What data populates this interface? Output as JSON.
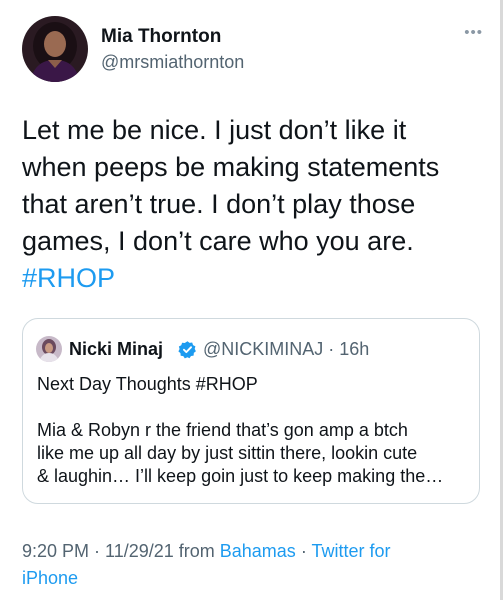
{
  "author": {
    "name": "Mia Thornton",
    "handle": "@mrsmiathornton"
  },
  "menu_icon": "more-horizontal-icon",
  "tweet_lines": [
    "Let me be nice.  I just don’t like it",
    "when peeps be making statements",
    "that aren’t true.  I don’t play those",
    "games, I don’t care who you are."
  ],
  "hashtag": "#RHOP",
  "quoted": {
    "name": "Nicki Minaj",
    "handle_time": "@NICKIMINAJ · 16h",
    "verified_icon": "verified-badge-icon",
    "line1": "Next Day Thoughts #RHOP",
    "lines": [
      "Mia & Robyn r the friend that’s gon amp a btch",
      "like me up all day by just sittin there, lookin cute",
      "& laughin… I’ll keep goin just to keep making the…"
    ]
  },
  "meta": {
    "timestamp": "9:20 PM · 11/29/21 from ",
    "location": "Bahamas",
    "separator": " · ",
    "source_part1": "Twitter for",
    "source_part2": "iPhone"
  },
  "colors": {
    "link": "#1d9bf0",
    "secondary_text": "#536471",
    "border": "#cfd9de"
  }
}
